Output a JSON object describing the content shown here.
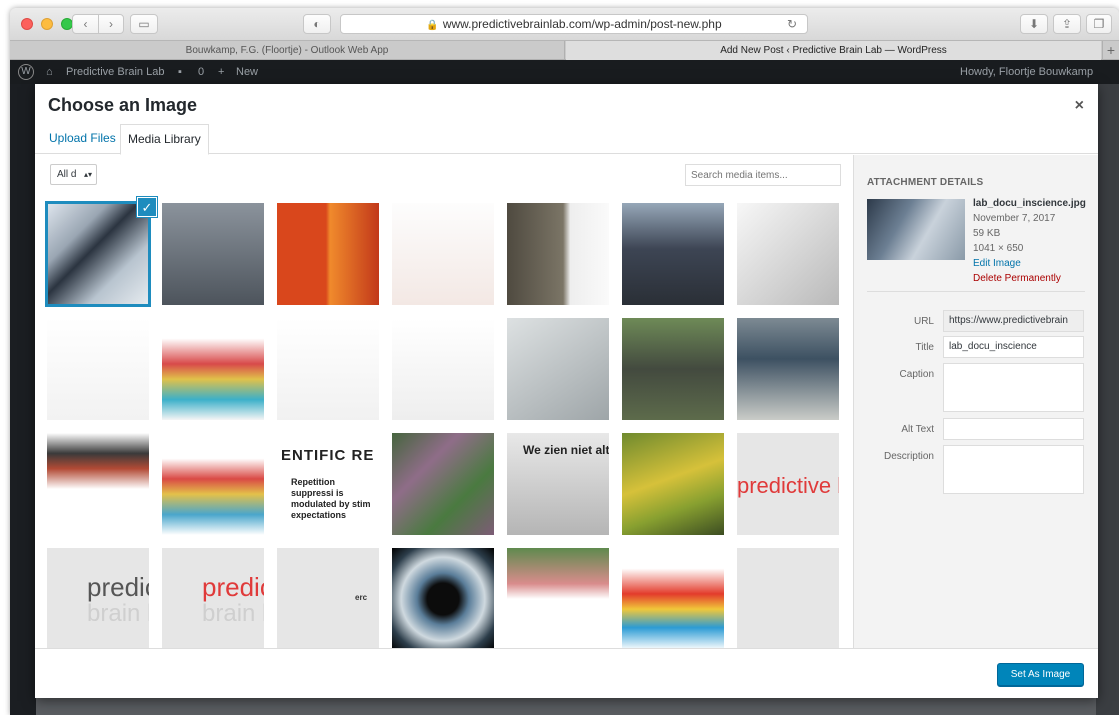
{
  "browser": {
    "url_text": "www.predictivebrainlab.com/wp-admin/post-new.php",
    "tabs": [
      {
        "label": "Bouwkamp, F.G. (Floortje) - Outlook Web App"
      },
      {
        "label": "Add New Post ‹ Predictive Brain Lab — WordPress"
      }
    ],
    "new_tab": "+"
  },
  "adminbar": {
    "site": "Predictive Brain Lab",
    "comments": "0",
    "new": "New",
    "howdy": "Howdy, Floortje Bouwkamp"
  },
  "modal": {
    "title": "Choose an Image",
    "close": "×",
    "tabs": {
      "upload": "Upload Files",
      "library": "Media Library"
    },
    "filter_value": "All d",
    "search_placeholder": "Search media items...",
    "thumbs": [
      {
        "caption": ""
      },
      {
        "caption": ""
      },
      {
        "caption": ""
      },
      {
        "caption": ""
      },
      {
        "caption": ""
      },
      {
        "caption": ""
      },
      {
        "caption": ""
      },
      {
        "caption": ""
      },
      {
        "caption": ""
      },
      {
        "caption": ""
      },
      {
        "caption": ""
      },
      {
        "caption": ""
      },
      {
        "caption": ""
      },
      {
        "caption": ""
      },
      {
        "caption": ""
      },
      {
        "caption": ""
      },
      {
        "caption": "ENTIFIC RE"
      },
      {
        "caption": ""
      },
      {
        "caption": "We zien niet alt"
      },
      {
        "caption": ""
      },
      {
        "caption": "predictive b"
      },
      {
        "caption": "predic"
      },
      {
        "caption": "predic"
      },
      {
        "caption": "erc"
      },
      {
        "caption": ""
      },
      {
        "caption": ""
      },
      {
        "caption": ""
      },
      {
        "caption": ""
      }
    ],
    "sub_captions": {
      "t16": "Repetition suppressi is modulated by stim expectations",
      "t21": "brain l",
      "t22": "brain l"
    },
    "footer_button": "Set As Image"
  },
  "details": {
    "heading": "Attachment Details",
    "filename": "lab_docu_inscience.jpg",
    "date": "November 7, 2017",
    "size": "59 KB",
    "dimensions": "1041 × 650",
    "edit_link": "Edit Image",
    "delete_link": "Delete Permanently",
    "fields": {
      "url_label": "URL",
      "url_value": "https://www.predictivebrain",
      "title_label": "Title",
      "title_value": "lab_docu_inscience",
      "caption_label": "Caption",
      "caption_value": "",
      "alt_label": "Alt Text",
      "alt_value": "",
      "desc_label": "Description",
      "desc_value": ""
    }
  },
  "colors": {
    "accent": "#0073aa",
    "selection": "#1e8cbe",
    "delete": "#aa0000",
    "button": "#0085ba"
  }
}
